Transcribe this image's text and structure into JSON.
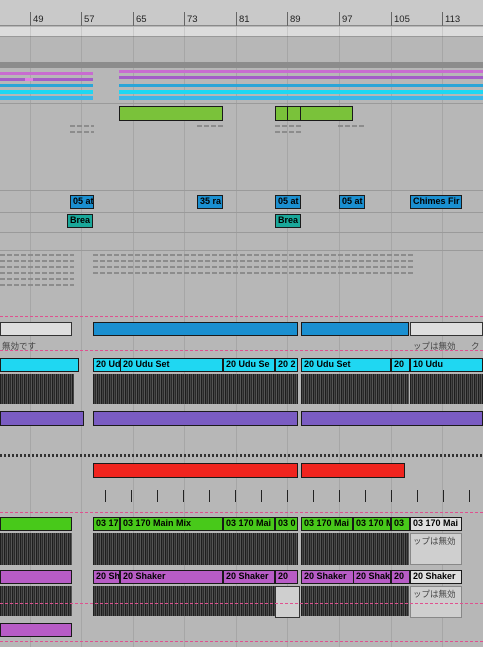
{
  "ruler": {
    "bar_numbers": [
      "49",
      "57",
      "65",
      "73",
      "81",
      "89",
      "97",
      "105",
      "113"
    ]
  },
  "colors": {
    "lane_bg": "#b7b7b7",
    "green": "#7ac23a",
    "light_blue": "#1a8fd0",
    "cyan": "#1fd7f2",
    "teal": "#1aa89a",
    "purple": "#7a5cc2",
    "red": "#f0241e",
    "bright_green": "#48c91a",
    "magenta": "#b85cc6",
    "loop_pink": "#e0508f"
  },
  "markers": {
    "blue_row": [
      "05 at",
      "35 ra",
      "05 at",
      "05 at",
      "Chimes Fir"
    ],
    "teal_row": [
      "Brea",
      "Brea"
    ]
  },
  "disabled_text": {
    "short": "無効です",
    "full": "ップは無効",
    "clip_off": "ップは無効",
    "k": "ク"
  },
  "clips": {
    "udu_row": [
      "20 Ud",
      "20 Udu Set",
      "20 Udu Se",
      "20 2",
      "20 Udu Set",
      "20",
      "10 Udu"
    ],
    "mainmix_row": [
      "03 17",
      "03 170 Main Mix",
      "03 170 Mai",
      "03 0",
      "03 170 Mai",
      "03 170 Ma",
      "03",
      "03 170 Mai"
    ],
    "shaker_row": [
      "20 Sh",
      "20 Shaker",
      "20 Shaker",
      "20",
      "20 Shaker",
      "20 Shak",
      "20",
      "20 Shaker"
    ]
  }
}
